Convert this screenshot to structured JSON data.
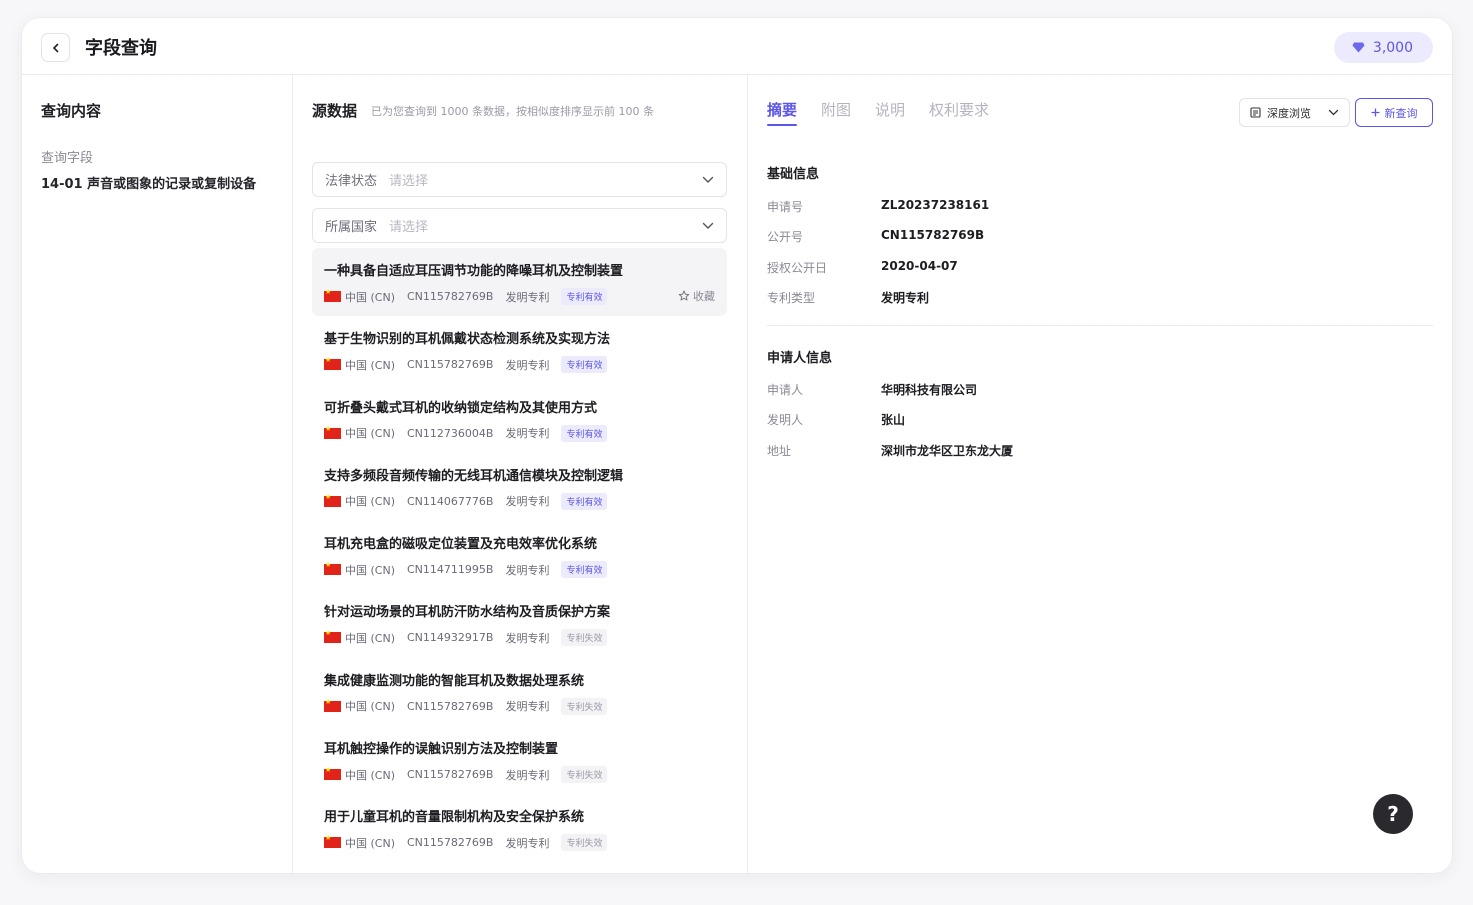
{
  "header": {
    "title": "字段查询",
    "credits": "3,000"
  },
  "left": {
    "title": "查询内容",
    "field_label": "查询字段",
    "field_value": "14-01 声音或图象的记录或复制设备"
  },
  "middle": {
    "title": "源数据",
    "hint": "已为您查询到 1000 条数据，按相似度排序显示前 100 条",
    "filters": [
      {
        "label": "法律状态",
        "placeholder": "请选择"
      },
      {
        "label": "所属国家",
        "placeholder": "请选择"
      }
    ],
    "fav_label": "收藏",
    "results": [
      {
        "title": "一种具备自适应耳压调节功能的降噪耳机及控制装置",
        "country": "中国 (CN)",
        "number": "CN115782769B",
        "type": "发明专利",
        "status": "专利有效"
      },
      {
        "title": "基于生物识别的耳机佩戴状态检测系统及实现方法",
        "country": "中国 (CN)",
        "number": "CN115782769B",
        "type": "发明专利",
        "status": "专利有效"
      },
      {
        "title": "可折叠头戴式耳机的收纳锁定结构及其使用方式",
        "country": "中国 (CN)",
        "number": "CN112736004B",
        "type": "发明专利",
        "status": "专利有效"
      },
      {
        "title": "支持多频段音频传输的无线耳机通信模块及控制逻辑",
        "country": "中国 (CN)",
        "number": "CN114067776B",
        "type": "发明专利",
        "status": "专利有效"
      },
      {
        "title": "耳机充电盒的磁吸定位装置及充电效率优化系统",
        "country": "中国 (CN)",
        "number": "CN114711995B",
        "type": "发明专利",
        "status": "专利有效"
      },
      {
        "title": "针对运动场景的耳机防汗防水结构及音质保护方案",
        "country": "中国 (CN)",
        "number": "CN114932917B",
        "type": "发明专利",
        "status": "专利失效"
      },
      {
        "title": "集成健康监测功能的智能耳机及数据处理系统",
        "country": "中国 (CN)",
        "number": "CN115782769B",
        "type": "发明专利",
        "status": "专利失效"
      },
      {
        "title": "耳机触控操作的误触识别方法及控制装置",
        "country": "中国 (CN)",
        "number": "CN115782769B",
        "type": "发明专利",
        "status": "专利失效"
      },
      {
        "title": "用于儿童耳机的音量限制机构及安全保护系统",
        "country": "中国 (CN)",
        "number": "CN115782769B",
        "type": "发明专利",
        "status": "专利失效"
      }
    ]
  },
  "right": {
    "tabs": [
      "摘要",
      "附图",
      "说明",
      "权利要求"
    ],
    "view_label": "深度浏览",
    "new_query_label": "新查询",
    "basic": {
      "title": "基础信息",
      "rows": [
        {
          "k": "申请号",
          "v": "ZL20237238161"
        },
        {
          "k": "公开号",
          "v": "CN115782769B"
        },
        {
          "k": "授权公开日",
          "v": "2020-04-07"
        },
        {
          "k": "专利类型",
          "v": "发明专利"
        }
      ]
    },
    "applicant": {
      "title": "申请人信息",
      "rows": [
        {
          "k": "申请人",
          "v": "华明科技有限公司"
        },
        {
          "k": "发明人",
          "v": "张山"
        },
        {
          "k": "地址",
          "v": "深圳市龙华区卫东龙大厦"
        }
      ]
    },
    "help": "?"
  },
  "colors": {
    "accent": "#5b55e8",
    "accent_bg": "#ecebfd"
  }
}
